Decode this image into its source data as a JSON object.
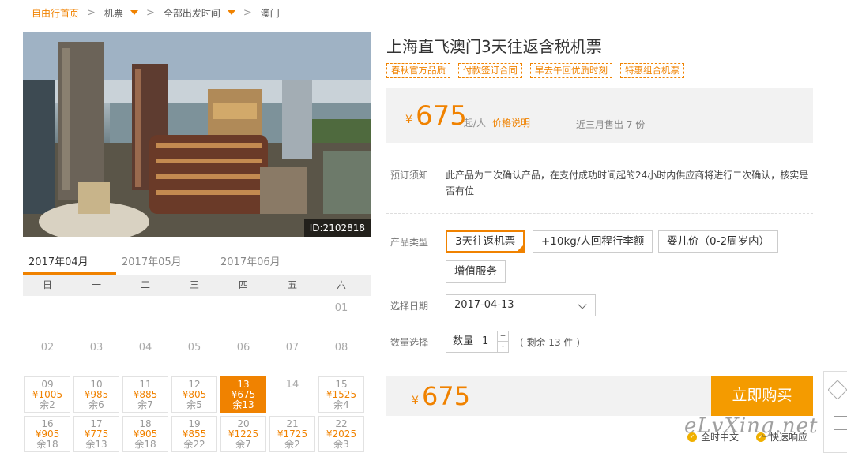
{
  "breadcrumb": {
    "home": "自由行首页",
    "sep": ">",
    "c1": "机票",
    "c2": "全部出发时间",
    "c3": "澳门"
  },
  "hero": {
    "id_tag": "ID:2102818"
  },
  "product": {
    "title": "上海直飞澳门3天往返含税机票",
    "tags": [
      "春秋官方品质",
      "付款签订合同",
      "早去午回优质时刻",
      "特惠组合机票"
    ],
    "currency": "¥",
    "price": "675",
    "per": "起/人",
    "price_explain": "价格说明",
    "sold": "近三月售出 7 份"
  },
  "notice": {
    "label": "预订须知",
    "text": "此产品为二次确认产品，在支付成功时间起的24小时内供应商将进行二次确认，核实是否有位"
  },
  "options": {
    "type_label": "产品类型",
    "types": [
      "3天往返机票",
      "+10kg/人回程行李额",
      "婴儿价（0-2周岁内）",
      "增值服务"
    ],
    "active_type": "3天往返机票",
    "date_label": "选择日期",
    "date_value": "2017-04-13",
    "qty_label": "数量选择",
    "qty_text": "数量",
    "qty_value": "1",
    "qty_up": "+",
    "qty_down": "-",
    "remain": "( 剩余 13 件 )"
  },
  "months": [
    "2017年04月",
    "2017年05月",
    "2017年06月"
  ],
  "active_month": "2017年04月",
  "weekdays": [
    "日",
    "一",
    "二",
    "三",
    "四",
    "五",
    "六"
  ],
  "calendar": {
    "row1": [
      {
        "d": "01"
      }
    ],
    "row2": [
      {
        "d": "02"
      },
      {
        "d": "03"
      },
      {
        "d": "04"
      },
      {
        "d": "05"
      },
      {
        "d": "06"
      },
      {
        "d": "07"
      },
      {
        "d": "08"
      }
    ],
    "row3": [
      {
        "d": "09",
        "p": "¥1005",
        "r": "余2"
      },
      {
        "d": "10",
        "p": "¥985",
        "r": "余6"
      },
      {
        "d": "11",
        "p": "¥885",
        "r": "余7"
      },
      {
        "d": "12",
        "p": "¥805",
        "r": "余5"
      },
      {
        "d": "13",
        "p": "¥675",
        "r": "余13",
        "selected": true
      },
      {
        "d": "14"
      },
      {
        "d": "15",
        "p": "¥1525",
        "r": "余4"
      }
    ],
    "row4": [
      {
        "d": "16",
        "p": "¥905",
        "r": "余18"
      },
      {
        "d": "17",
        "p": "¥775",
        "r": "余13"
      },
      {
        "d": "18",
        "p": "¥905",
        "r": "余18"
      },
      {
        "d": "19",
        "p": "¥855",
        "r": "余22"
      },
      {
        "d": "20",
        "p": "¥1225",
        "r": "余7"
      },
      {
        "d": "21",
        "p": "¥1725",
        "r": "余2"
      },
      {
        "d": "22",
        "p": "¥2025",
        "r": "余3"
      }
    ]
  },
  "buy": {
    "currency": "¥",
    "price": "675",
    "button": "立即购买"
  },
  "features": [
    "全时中文",
    "快速响应"
  ],
  "watermark": "eLvXing.net",
  "colors": {
    "accent": "#f08200",
    "button": "#f49b00",
    "panel": "#f2f2f2"
  }
}
